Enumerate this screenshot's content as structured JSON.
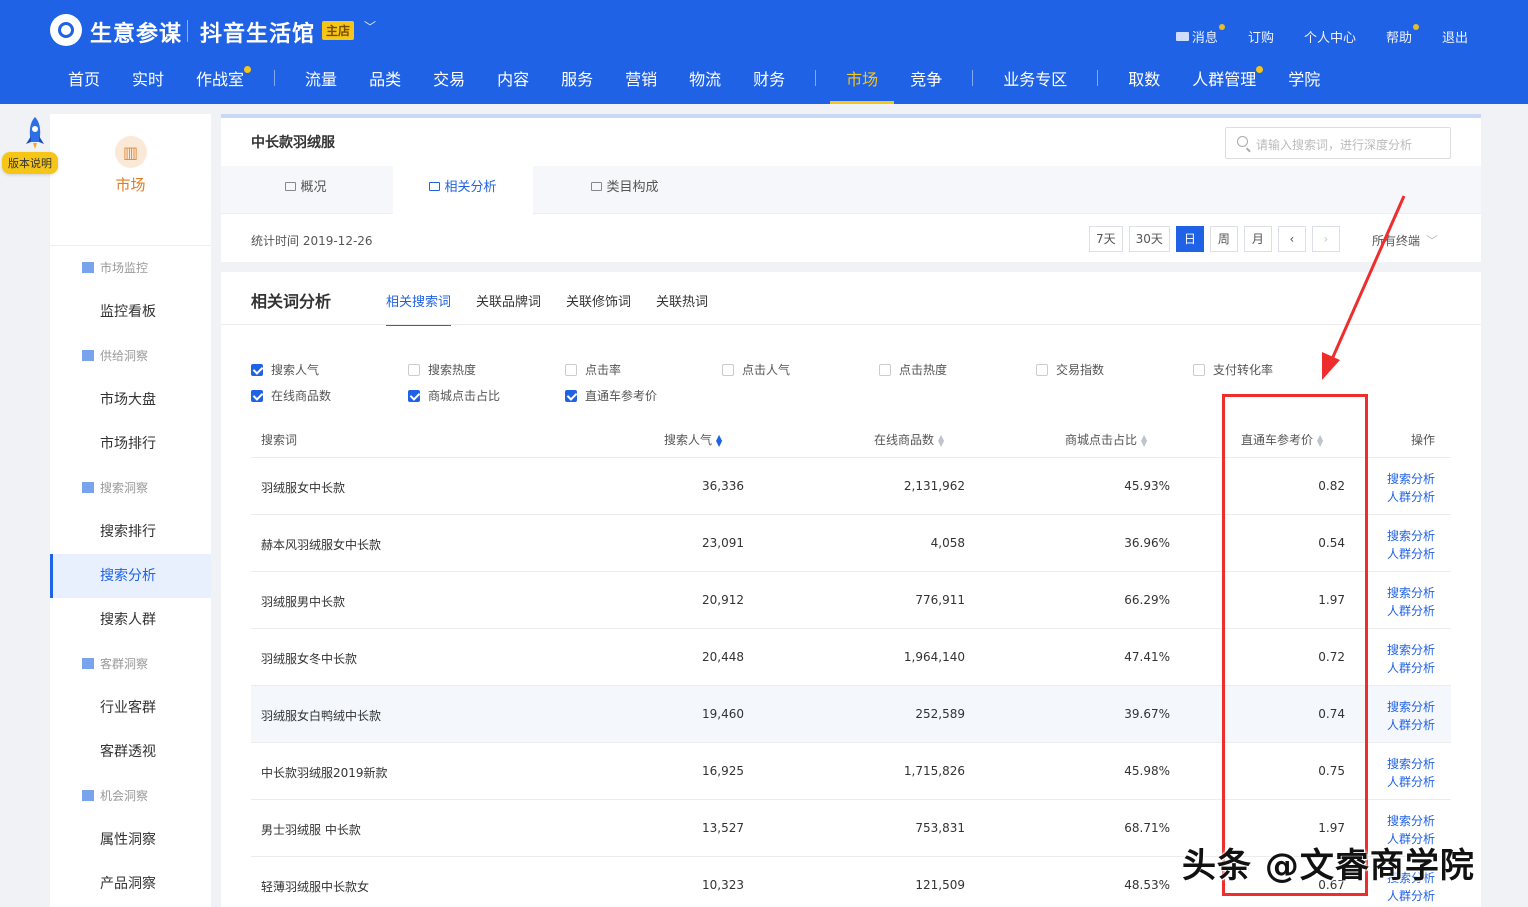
{
  "header": {
    "brand": "生意参谋",
    "shop_name": "抖音生活馆",
    "shop_badge": "主店",
    "right_links": [
      {
        "label": "消息",
        "dot": true
      },
      {
        "label": "订购",
        "dot": false
      },
      {
        "label": "个人中心",
        "dot": false
      },
      {
        "label": "帮助",
        "dot": true
      },
      {
        "label": "退出",
        "dot": false
      }
    ],
    "nav": [
      "首页",
      "实时",
      "作战室",
      "流量",
      "品类",
      "交易",
      "内容",
      "服务",
      "营销",
      "物流",
      "财务",
      "市场",
      "竞争",
      "业务专区",
      "取数",
      "人群管理",
      "学院"
    ],
    "active_nav": "市场",
    "brand_color": "#2062e6",
    "accent_color": "#f5c518"
  },
  "version_badge": "版本说明",
  "sidebar": {
    "head_label": "市场",
    "groups": [
      {
        "label": "市场监控",
        "items": [
          "监控看板"
        ]
      },
      {
        "label": "供给洞察",
        "items": [
          "市场大盘",
          "市场排行"
        ]
      },
      {
        "label": "搜索洞察",
        "items": [
          "搜索排行",
          "搜索分析",
          "搜索人群"
        ]
      },
      {
        "label": "客群洞察",
        "items": [
          "行业客群",
          "客群透视"
        ]
      },
      {
        "label": "机会洞察",
        "items": [
          "属性洞察",
          "产品洞察"
        ]
      }
    ],
    "active_item": "搜索分析"
  },
  "top_card": {
    "title": "中长款羽绒服",
    "search_placeholder": "请输入搜索词，进行深度分析",
    "tabs": [
      "概况",
      "相关分析",
      "类目构成"
    ],
    "active_tab": "相关分析",
    "stat_time": "统计时间 2019-12-26",
    "period_buttons": [
      "7天",
      "30天",
      "日",
      "周",
      "月",
      "‹",
      "›"
    ],
    "active_period": "日",
    "terminal": "所有终端"
  },
  "main_card": {
    "title": "相关词分析",
    "sub_tabs": [
      "相关搜索词",
      "关联品牌词",
      "关联修饰词",
      "关联热词"
    ],
    "active_sub_tab": "相关搜索词",
    "checkboxes_row1": [
      {
        "label": "搜索人气",
        "checked": true
      },
      {
        "label": "搜索热度",
        "checked": false
      },
      {
        "label": "点击率",
        "checked": false
      },
      {
        "label": "点击人气",
        "checked": false
      },
      {
        "label": "点击热度",
        "checked": false
      },
      {
        "label": "交易指数",
        "checked": false
      },
      {
        "label": "支付转化率",
        "checked": false
      }
    ],
    "checkboxes_row2": [
      {
        "label": "在线商品数",
        "checked": true
      },
      {
        "label": "商城点击占比",
        "checked": true
      },
      {
        "label": "直通车参考价",
        "checked": true
      }
    ],
    "columns": [
      "搜索词",
      "搜索人气",
      "在线商品数",
      "商城点击占比",
      "直通车参考价",
      "操作"
    ],
    "action_labels": [
      "搜索分析",
      "人群分析"
    ],
    "rows": [
      {
        "keyword": "羽绒服女中长款",
        "popularity": "36,336",
        "items": "2,131,962",
        "mall_ratio": "45.93%",
        "ztc_price": "0.82"
      },
      {
        "keyword": "赫本风羽绒服女中长款",
        "popularity": "23,091",
        "items": "4,058",
        "mall_ratio": "36.96%",
        "ztc_price": "0.54"
      },
      {
        "keyword": "羽绒服男中长款",
        "popularity": "20,912",
        "items": "776,911",
        "mall_ratio": "66.29%",
        "ztc_price": "1.97"
      },
      {
        "keyword": "羽绒服女冬中长款",
        "popularity": "20,448",
        "items": "1,964,140",
        "mall_ratio": "47.41%",
        "ztc_price": "0.72"
      },
      {
        "keyword": "羽绒服女白鸭绒中长款",
        "popularity": "19,460",
        "items": "252,589",
        "mall_ratio": "39.67%",
        "ztc_price": "0.74"
      },
      {
        "keyword": "中长款羽绒服2019新款",
        "popularity": "16,925",
        "items": "1,715,826",
        "mall_ratio": "45.98%",
        "ztc_price": "0.75"
      },
      {
        "keyword": "男士羽绒服 中长款",
        "popularity": "13,527",
        "items": "753,831",
        "mall_ratio": "68.71%",
        "ztc_price": "1.97"
      },
      {
        "keyword": "轻薄羽绒服中长款女",
        "popularity": "10,323",
        "items": "121,509",
        "mall_ratio": "48.53%",
        "ztc_price": "0.67"
      }
    ]
  },
  "watermark": "头条 @文睿商学院"
}
